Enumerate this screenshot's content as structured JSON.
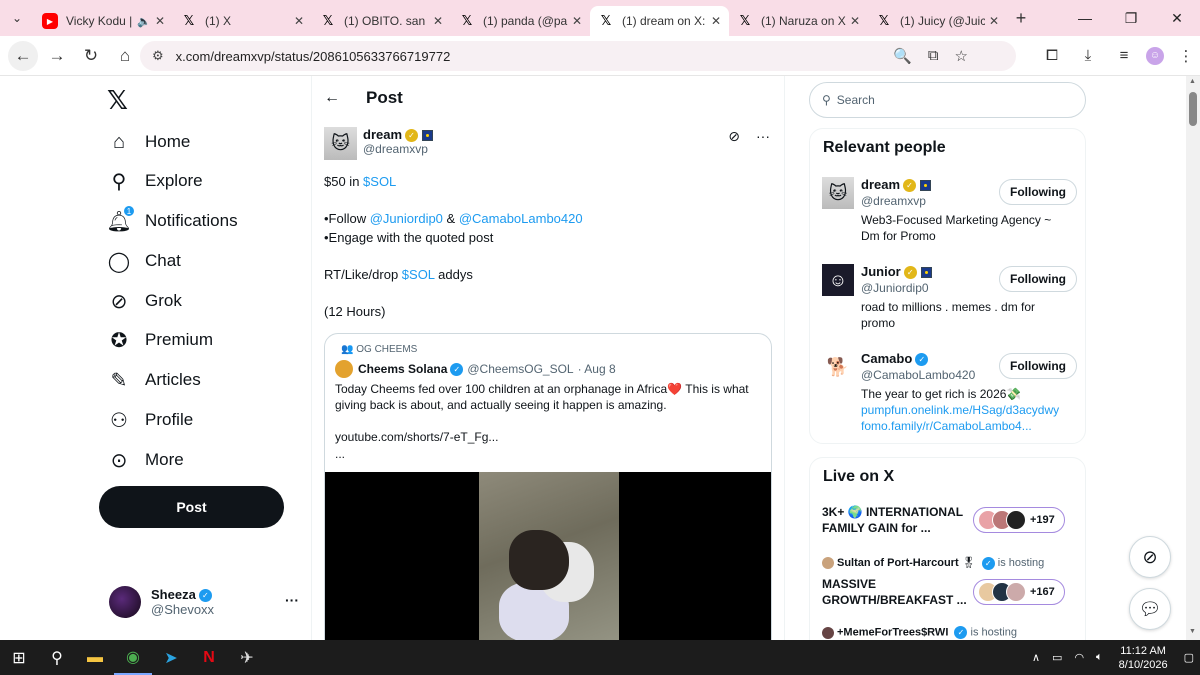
{
  "browser": {
    "tabs": [
      {
        "title": "Vicky Kodu |",
        "favicon": "youtube-icon",
        "muted": true,
        "active": false
      },
      {
        "title": "(1) X",
        "favicon": "x-icon",
        "active": false
      },
      {
        "title": "(1) OBITO. san",
        "favicon": "x-icon",
        "active": false
      },
      {
        "title": "(1) panda (@par",
        "favicon": "x-icon",
        "active": false
      },
      {
        "title": "(1) dream on X:",
        "favicon": "x-icon",
        "active": true
      },
      {
        "title": "(1) Naruza on X",
        "favicon": "x-icon",
        "active": false
      },
      {
        "title": "(1) Juicy (@Juicy",
        "favicon": "x-icon",
        "active": false
      }
    ],
    "url": "x.com/dreamxvp/status/2086105633766719772"
  },
  "nav": {
    "items": [
      {
        "label": "Home",
        "icon": "home-icon"
      },
      {
        "label": "Explore",
        "icon": "search-icon"
      },
      {
        "label": "Notifications",
        "icon": "bell-icon",
        "badge": "1"
      },
      {
        "label": "Chat",
        "icon": "chat-icon"
      },
      {
        "label": "Grok",
        "icon": "grok-icon"
      },
      {
        "label": "Premium",
        "icon": "premium-icon"
      },
      {
        "label": "Articles",
        "icon": "articles-icon"
      },
      {
        "label": "Profile",
        "icon": "person-icon"
      },
      {
        "label": "More",
        "icon": "more-circle-icon"
      }
    ],
    "post_label": "Post",
    "account": {
      "name": "Sheeza",
      "handle": "@Shevoxx"
    }
  },
  "main": {
    "title": "Post",
    "author": {
      "name": "dream",
      "handle": "@dreamxvp"
    },
    "text": {
      "l1a": "$50 in ",
      "l1b": "$SOL",
      "l2a": "•Follow ",
      "l2b": "@Juniordip0",
      "l2c": " & ",
      "l2d": "@CamaboLambo420",
      "l3": "•Engage with the quoted post",
      "l4a": "RT/Like/drop ",
      "l4b": "$SOL",
      "l4c": " addys",
      "l5": "(12 Hours)"
    },
    "quote": {
      "community": "OG CHEEMS",
      "name": "Cheems Solana",
      "handle": "@CheemsOG_SOL",
      "date": "· Aug 8",
      "text": "Today Cheems fed over 100 children at an orphanage in Africa❤️ This is what giving back is about, and actually seeing it happen is amazing.",
      "link": "youtube.com/shorts/7-eT_Fg...",
      "ellipsis": "..."
    }
  },
  "sidebar": {
    "search_placeholder": "Search",
    "relevant_title": "Relevant people",
    "people": [
      {
        "name": "dream",
        "handle": "@dreamxvp",
        "bio": "Web3-Focused Marketing Agency ~ Dm for Promo",
        "bio2": "",
        "bio3": "",
        "button": "Following"
      },
      {
        "name": "Junior",
        "handle": "@Juniordip0",
        "bio": "road to millions . memes . dm for promo",
        "bio2": "",
        "bio3": "",
        "button": "Following"
      },
      {
        "name": "Camabo",
        "handle": "@CamaboLambo420",
        "bio": "The year to get rich is 2026💸",
        "bio2": "pumpfun.onelink.me/HSag/d3acydwy",
        "bio3": "fomo.family/r/CamaboLambo4...",
        "button": "Following"
      }
    ],
    "live_title": "Live on X",
    "live": [
      {
        "title": "3K+ 🌍 INTERNATIONAL FAMILY GAIN for ...",
        "count": "+197"
      },
      {
        "host": "Sultan of Port-Harcourt",
        "status": "is hosting",
        "title": "MASSIVE GROWTH/BREAKFAST ...",
        "count": "+167"
      },
      {
        "host": "+MemeForTrees$RWI",
        "status": "is hosting"
      }
    ]
  },
  "taskbar": {
    "time": "11:12 AM",
    "date": "8/10/2026"
  }
}
